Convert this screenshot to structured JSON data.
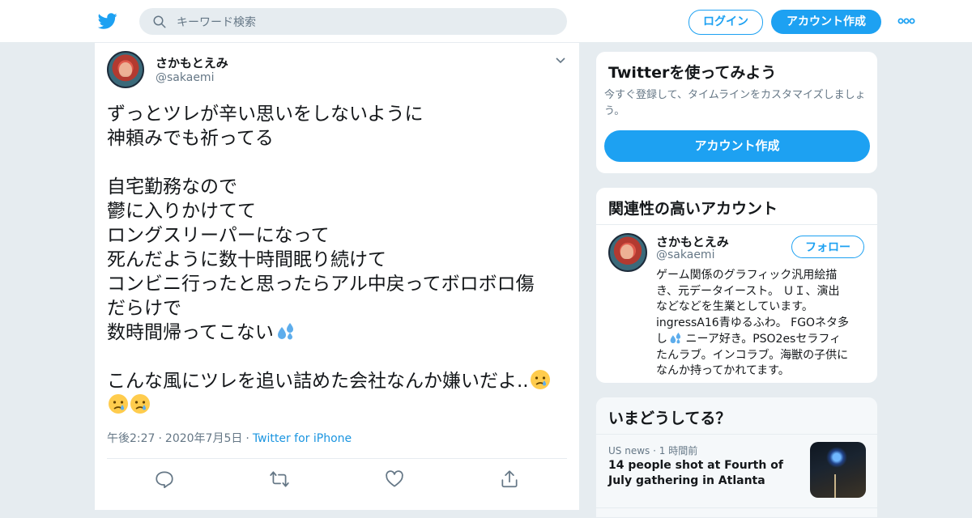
{
  "header": {
    "search_placeholder": "キーワード検索",
    "login_label": "ログイン",
    "signup_label": "アカウント作成"
  },
  "tweet": {
    "author_name": "さかもとえみ",
    "author_handle": "@sakaemi",
    "lines": [
      "ずっとツレが辛い思いをしないように",
      "神頼みでも祈ってる",
      "",
      "自宅勤務なので",
      "鬱に入りかけてて",
      "ロングスリーパーになって",
      "死んだように数十時間眠り続けて",
      "コンビニ行ったと思ったらアル中戻ってボロボロ傷",
      "だらけで",
      "数時間帰ってこない",
      "",
      "こんな風にツレを追い詰めた会社なんか嫌いだよ.."
    ],
    "time": "午後2:27",
    "date": "2020年7月5日",
    "source": "Twitter for iPhone",
    "meta_separator": "·"
  },
  "signup_panel": {
    "title": "Twitterを使ってみよう",
    "description": "今すぐ登録して、タイムラインをカスタマイズしましょう。",
    "button_label": "アカウント作成"
  },
  "related_panel": {
    "title": "関連性の高いアカウント",
    "name": "さかもとえみ",
    "handle": "@sakaemi",
    "follow_label": "フォロー",
    "bio_lines": [
      "ゲーム関係のグラフィック汎用絵描",
      "き、元データイースト。 ＵＩ、演出",
      "などなどを生業としています。",
      "ingressA16青ゆるふわ。 FGOネタ多",
      "ニーア好き。PSO2esセラフィ",
      "たんラブ。インコラブ。海獣の子供に",
      "なんか持ってかれてます。"
    ],
    "bio_line5_prefix": "し"
  },
  "trends_panel": {
    "title": "いまどうしてる？",
    "category": "US news",
    "separator": "·",
    "time_ago": "1 時間前",
    "headline": "14 people shot at Fourth of July gathering in Atlanta"
  },
  "colors": {
    "brand": "#1da1f2",
    "link": "#1b95e0",
    "muted": "#657786",
    "background": "#e6ecf0"
  },
  "icons": {
    "logo": "twitter-bird-icon",
    "search": "search-icon",
    "more": "more-dots-icon",
    "reply": "reply-icon",
    "retweet": "retweet-icon",
    "like": "heart-icon",
    "share": "share-icon",
    "sweat": "sweat-droplets-emoji",
    "crying": "crying-face-emoji"
  }
}
